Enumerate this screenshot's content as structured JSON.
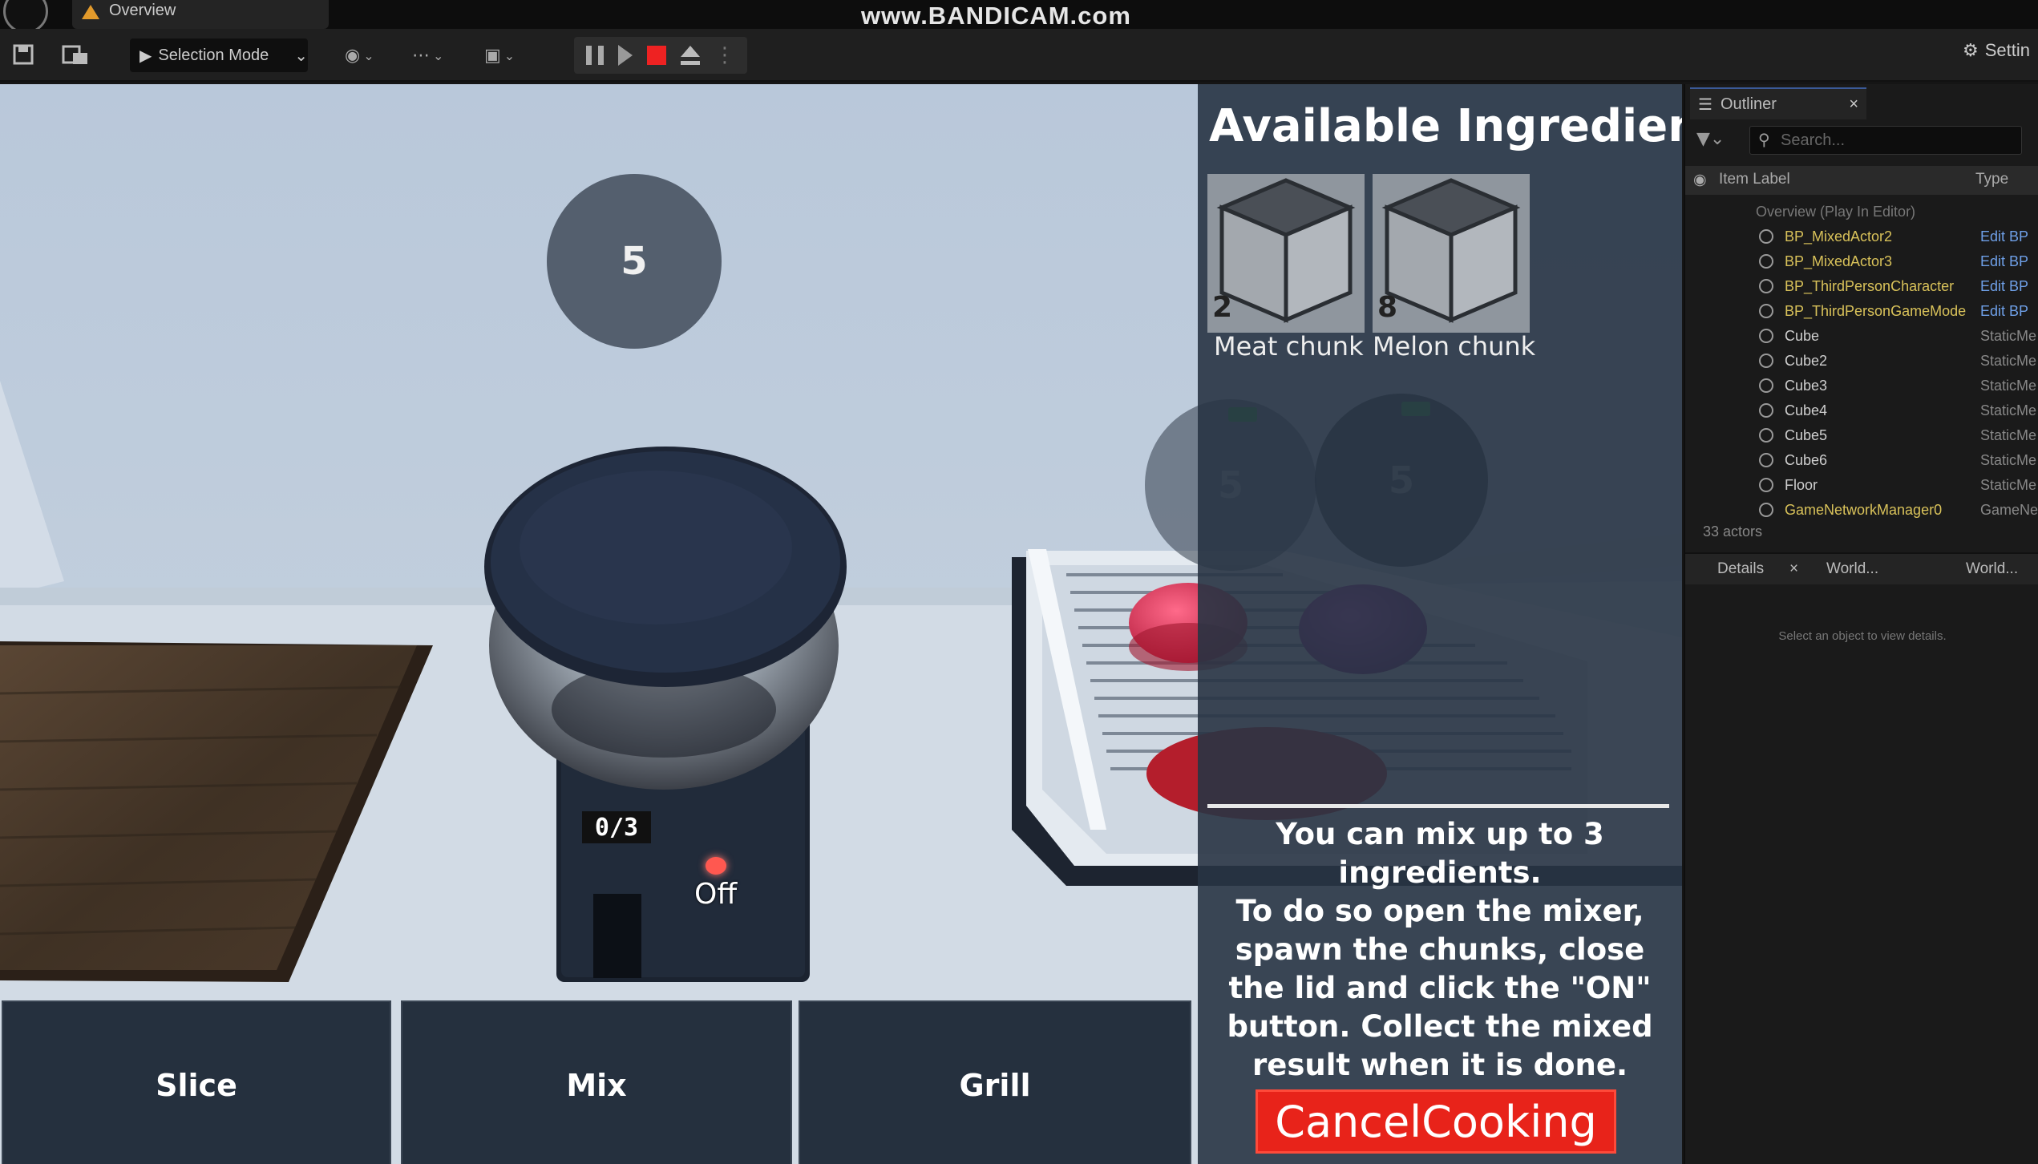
{
  "window": {
    "level_tab": "Overview",
    "watermark": "www.BANDICAM.com"
  },
  "toolbar": {
    "selection_mode": "Selection Mode",
    "settings_label": "Settin"
  },
  "viewport": {
    "timer_main": "5",
    "timer_grill_1": "5",
    "timer_grill_2": "5",
    "mixer_count": "0/3",
    "mixer_switch": "Off",
    "actions": [
      "Slice",
      "Mix",
      "Grill"
    ]
  },
  "ingredients": {
    "title": "Available Ingredients",
    "items": [
      {
        "name": "Meat chunk",
        "count": "2"
      },
      {
        "name": "Melon chunk",
        "count": "8"
      }
    ],
    "instructions": "You can mix up to 3 ingredients.\nTo do so open the mixer, spawn the chunks, close the lid and click the \"ON\" button. Collect the mixed result when it is done.",
    "cancel_label": "CancelCooking"
  },
  "outliner": {
    "tab_label": "Outliner",
    "search_placeholder": "Search...",
    "col_label": "Item Label",
    "col_type": "Type",
    "root_label": "Overview (Play In Editor)",
    "rows": [
      {
        "name": "BP_MixedActor2",
        "type": "Edit BP",
        "kind": "bp"
      },
      {
        "name": "BP_MixedActor3",
        "type": "Edit BP",
        "kind": "bp"
      },
      {
        "name": "BP_ThirdPersonCharacter",
        "type": "Edit BP",
        "kind": "bp"
      },
      {
        "name": "BP_ThirdPersonGameMode",
        "type": "Edit BP",
        "kind": "bp"
      },
      {
        "name": "Cube",
        "type": "StaticMe",
        "kind": "mesh"
      },
      {
        "name": "Cube2",
        "type": "StaticMe",
        "kind": "mesh"
      },
      {
        "name": "Cube3",
        "type": "StaticMe",
        "kind": "mesh"
      },
      {
        "name": "Cube4",
        "type": "StaticMe",
        "kind": "mesh"
      },
      {
        "name": "Cube5",
        "type": "StaticMe",
        "kind": "mesh"
      },
      {
        "name": "Cube6",
        "type": "StaticMe",
        "kind": "mesh"
      },
      {
        "name": "Floor",
        "type": "StaticMe",
        "kind": "mesh"
      },
      {
        "name": "GameNetworkManager0",
        "type": "GameNe",
        "kind": "bp"
      }
    ],
    "actor_count": "33 actors",
    "details_tab": "Details",
    "world_tab_1": "World...",
    "world_tab_2": "World...",
    "details_empty": "Select an object to view details."
  },
  "colors": {
    "bp_name": "#d9c25a",
    "bp_type": "#6fa0e8",
    "mesh_name": "#cfcfcf",
    "mesh_type": "#888888"
  }
}
